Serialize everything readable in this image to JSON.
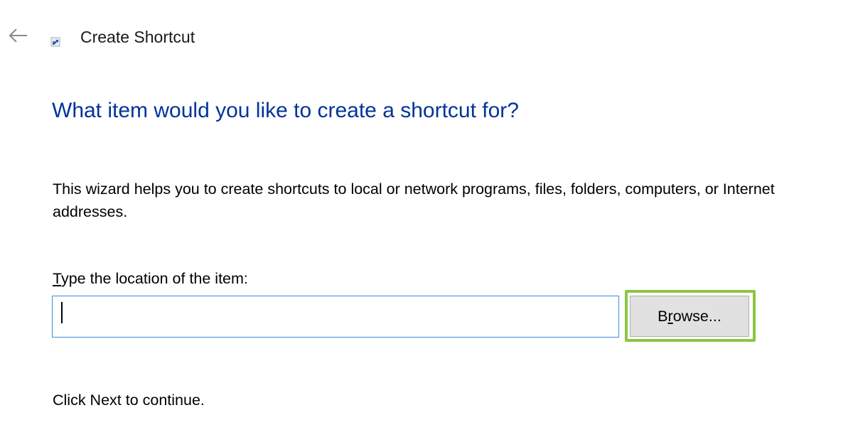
{
  "window": {
    "title": "Create Shortcut",
    "back_icon": "left-arrow-icon",
    "title_icon": "shortcut-icon"
  },
  "wizard": {
    "heading": "What item would you like to create a shortcut for?",
    "description": "This wizard helps you to create shortcuts to local or network programs, files, folders, computers, or Internet addresses.",
    "location_label": {
      "mnemonic": "T",
      "rest": "ype the location of the item:"
    },
    "location_value": "",
    "browse_button": {
      "before": "B",
      "mnemonic": "r",
      "after": "owse..."
    },
    "footer": "Click Next to continue."
  },
  "colors": {
    "heading": "#003399",
    "input_border": "#3c8ddb",
    "highlight": "#8cc63f",
    "button_bg": "#e1e1e1"
  }
}
